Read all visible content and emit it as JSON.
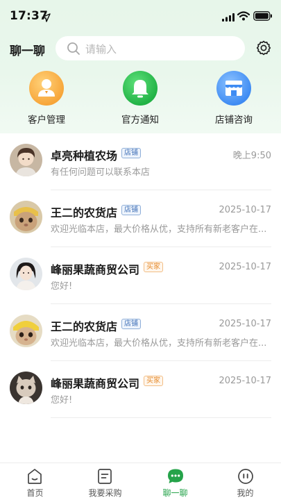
{
  "status_bar": {
    "time": "17:37"
  },
  "header": {
    "title": "聊一聊",
    "search_placeholder": "请输入"
  },
  "shortcuts": [
    {
      "label": "客户管理",
      "icon": "customer-icon"
    },
    {
      "label": "官方通知",
      "icon": "bell-icon"
    },
    {
      "label": "店铺咨询",
      "icon": "shop-icon"
    }
  ],
  "chats": [
    {
      "name": "卓亮种植农场",
      "tag": "店铺",
      "tag_type": "shop",
      "time": "晚上9:50",
      "message": "有任何问题可以联系本店"
    },
    {
      "name": "王二的农货店",
      "tag": "店铺",
      "tag_type": "shop",
      "time": "2025-10-17",
      "message": "欢迎光临本店，最大价格从优，支持所有新老客户在..."
    },
    {
      "name": "峰丽果蔬商贸公司",
      "tag": "买家",
      "tag_type": "buyer",
      "time": "2025-10-17",
      "message": "您好!"
    },
    {
      "name": "王二的农货店",
      "tag": "店铺",
      "tag_type": "shop",
      "time": "2025-10-17",
      "message": "欢迎光临本店，最大价格从优，支持所有新老客户在..."
    },
    {
      "name": "峰丽果蔬商贸公司",
      "tag": "买家",
      "tag_type": "buyer",
      "time": "2025-10-17",
      "message": "您好!"
    }
  ],
  "bottom_nav": [
    {
      "label": "首页",
      "icon": "home-icon",
      "active": false
    },
    {
      "label": "我要采购",
      "icon": "purchase-icon",
      "active": false
    },
    {
      "label": "聊一聊",
      "icon": "chat-icon",
      "active": true
    },
    {
      "label": "我的",
      "icon": "profile-icon",
      "active": false
    }
  ],
  "colors": {
    "accent": "#25a34a",
    "shop_tag": "#3f6fb6",
    "buyer_tag": "#e58a2c"
  }
}
